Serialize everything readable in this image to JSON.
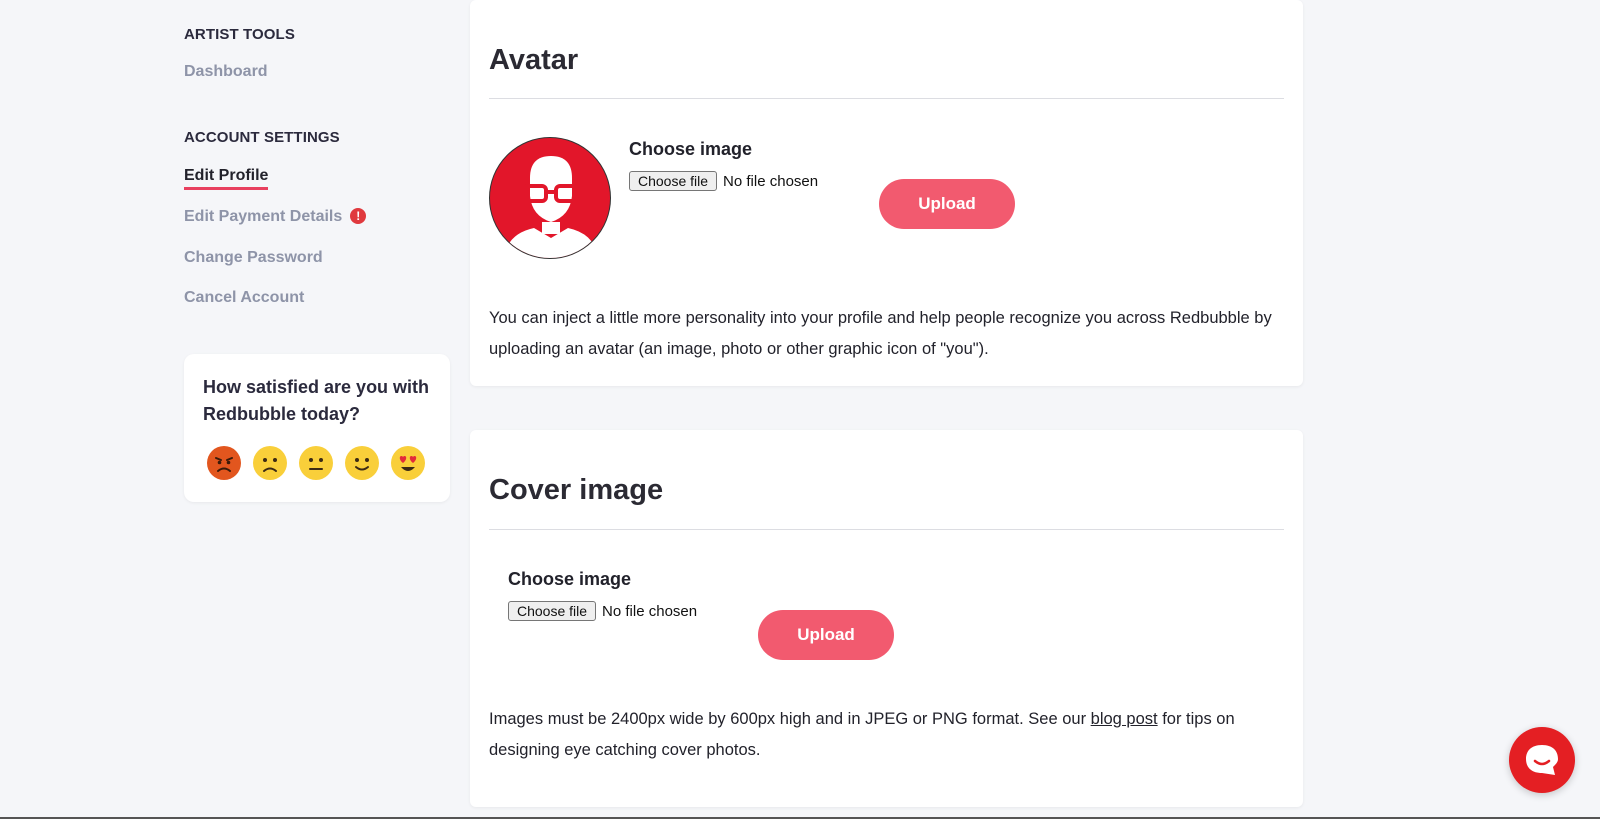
{
  "sidebar": {
    "artist_tools_heading": "ARTIST TOOLS",
    "dashboard": "Dashboard",
    "account_settings_heading": "ACCOUNT SETTINGS",
    "edit_profile": "Edit Profile",
    "edit_payment": "Edit Payment Details",
    "payment_alert": "!",
    "change_password": "Change Password",
    "cancel_account": "Cancel Account"
  },
  "survey": {
    "question": "How satisfied are you with Redbubble today?",
    "options": [
      "angry-face-icon",
      "frowning-face-icon",
      "neutral-face-icon",
      "slightly-smiling-face-icon",
      "heart-eyes-face-icon"
    ]
  },
  "avatar": {
    "title": "Avatar",
    "choose_label": "Choose image",
    "file_button": "Choose file",
    "file_status": "No file chosen",
    "upload": "Upload",
    "description": "You can inject a little more personality into your profile and help people recognize you across Redbubble by uploading an avatar (an image, photo or other graphic icon of \"you\")."
  },
  "cover": {
    "title": "Cover image",
    "choose_label": "Choose image",
    "file_button": "Choose file",
    "file_status": "No file chosen",
    "upload": "Upload",
    "description_before": "Images must be 2400px wide by 600px high and in JPEG or PNG format. See our ",
    "link": "blog post",
    "description_after": " for tips on designing eye catching cover photos."
  },
  "colors": {
    "accent": "#f25a6f",
    "alert": "#e0393e",
    "chat": "#e41f23",
    "avatar_bg": "#e2162a"
  }
}
